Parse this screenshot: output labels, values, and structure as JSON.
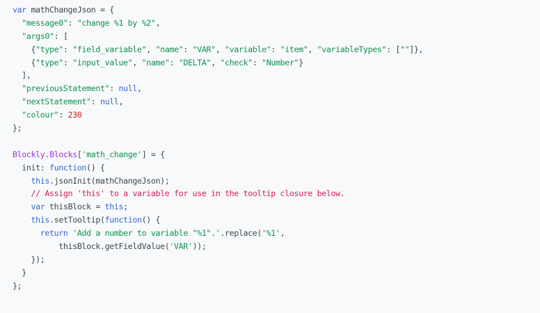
{
  "colors": {
    "background": "#f8f9fa",
    "plain": "#37474f",
    "keyword": "#3367d6",
    "string": "#0d904f",
    "number": "#c5221f",
    "comment": "#d81b60",
    "identifier": "#9334e6"
  },
  "code": {
    "lines": [
      [
        {
          "t": "kw",
          "v": "var"
        },
        {
          "t": "pl",
          "v": " mathChangeJson = {"
        }
      ],
      [
        {
          "t": "pl",
          "v": "  "
        },
        {
          "t": "str",
          "v": "\"message0\""
        },
        {
          "t": "pl",
          "v": ": "
        },
        {
          "t": "str",
          "v": "\"change %1 by %2\""
        },
        {
          "t": "pl",
          "v": ","
        }
      ],
      [
        {
          "t": "pl",
          "v": "  "
        },
        {
          "t": "str",
          "v": "\"args0\""
        },
        {
          "t": "pl",
          "v": ": ["
        }
      ],
      [
        {
          "t": "pl",
          "v": "    {"
        },
        {
          "t": "str",
          "v": "\"type\""
        },
        {
          "t": "pl",
          "v": ": "
        },
        {
          "t": "str",
          "v": "\"field_variable\""
        },
        {
          "t": "pl",
          "v": ", "
        },
        {
          "t": "str",
          "v": "\"name\""
        },
        {
          "t": "pl",
          "v": ": "
        },
        {
          "t": "str",
          "v": "\"VAR\""
        },
        {
          "t": "pl",
          "v": ", "
        },
        {
          "t": "str",
          "v": "\"variable\""
        },
        {
          "t": "pl",
          "v": ": "
        },
        {
          "t": "str",
          "v": "\"item\""
        },
        {
          "t": "pl",
          "v": ", "
        },
        {
          "t": "str",
          "v": "\"variableTypes\""
        },
        {
          "t": "pl",
          "v": ": ["
        },
        {
          "t": "str",
          "v": "\"\""
        },
        {
          "t": "pl",
          "v": "]},"
        }
      ],
      [
        {
          "t": "pl",
          "v": "    {"
        },
        {
          "t": "str",
          "v": "\"type\""
        },
        {
          "t": "pl",
          "v": ": "
        },
        {
          "t": "str",
          "v": "\"input_value\""
        },
        {
          "t": "pl",
          "v": ", "
        },
        {
          "t": "str",
          "v": "\"name\""
        },
        {
          "t": "pl",
          "v": ": "
        },
        {
          "t": "str",
          "v": "\"DELTA\""
        },
        {
          "t": "pl",
          "v": ", "
        },
        {
          "t": "str",
          "v": "\"check\""
        },
        {
          "t": "pl",
          "v": ": "
        },
        {
          "t": "str",
          "v": "\"Number\""
        },
        {
          "t": "pl",
          "v": "}"
        }
      ],
      [
        {
          "t": "pl",
          "v": "  ],"
        }
      ],
      [
        {
          "t": "pl",
          "v": "  "
        },
        {
          "t": "str",
          "v": "\"previousStatement\""
        },
        {
          "t": "pl",
          "v": ": "
        },
        {
          "t": "kw",
          "v": "null"
        },
        {
          "t": "pl",
          "v": ","
        }
      ],
      [
        {
          "t": "pl",
          "v": "  "
        },
        {
          "t": "str",
          "v": "\"nextStatement\""
        },
        {
          "t": "pl",
          "v": ": "
        },
        {
          "t": "kw",
          "v": "null"
        },
        {
          "t": "pl",
          "v": ","
        }
      ],
      [
        {
          "t": "pl",
          "v": "  "
        },
        {
          "t": "str",
          "v": "\"colour\""
        },
        {
          "t": "pl",
          "v": ": "
        },
        {
          "t": "num",
          "v": "230"
        }
      ],
      [
        {
          "t": "pl",
          "v": "};"
        }
      ],
      [
        {
          "t": "pl",
          "v": ""
        }
      ],
      [
        {
          "t": "fn",
          "v": "Blockly"
        },
        {
          "t": "pl",
          "v": "."
        },
        {
          "t": "fn",
          "v": "Blocks"
        },
        {
          "t": "pl",
          "v": "["
        },
        {
          "t": "str",
          "v": "'math_change'"
        },
        {
          "t": "pl",
          "v": "] = {"
        }
      ],
      [
        {
          "t": "pl",
          "v": "  init: "
        },
        {
          "t": "kw",
          "v": "function"
        },
        {
          "t": "pl",
          "v": "() {"
        }
      ],
      [
        {
          "t": "pl",
          "v": "    "
        },
        {
          "t": "kw",
          "v": "this"
        },
        {
          "t": "pl",
          "v": ".jsonInit(mathChangeJson);"
        }
      ],
      [
        {
          "t": "pl",
          "v": "    "
        },
        {
          "t": "cmt",
          "v": "// Assign 'this' to a variable for use in the tooltip closure below."
        }
      ],
      [
        {
          "t": "pl",
          "v": "    "
        },
        {
          "t": "kw",
          "v": "var"
        },
        {
          "t": "pl",
          "v": " thisBlock = "
        },
        {
          "t": "kw",
          "v": "this"
        },
        {
          "t": "pl",
          "v": ";"
        }
      ],
      [
        {
          "t": "pl",
          "v": "    "
        },
        {
          "t": "kw",
          "v": "this"
        },
        {
          "t": "pl",
          "v": ".setTooltip("
        },
        {
          "t": "kw",
          "v": "function"
        },
        {
          "t": "pl",
          "v": "() {"
        }
      ],
      [
        {
          "t": "pl",
          "v": "      "
        },
        {
          "t": "kw",
          "v": "return"
        },
        {
          "t": "pl",
          "v": " "
        },
        {
          "t": "str",
          "v": "'Add a number to variable \"%1\".'"
        },
        {
          "t": "pl",
          "v": ".replace("
        },
        {
          "t": "str",
          "v": "'%1'"
        },
        {
          "t": "pl",
          "v": ","
        }
      ],
      [
        {
          "t": "pl",
          "v": "          thisBlock.getFieldValue("
        },
        {
          "t": "str",
          "v": "'VAR'"
        },
        {
          "t": "pl",
          "v": "));"
        }
      ],
      [
        {
          "t": "pl",
          "v": "    });"
        }
      ],
      [
        {
          "t": "pl",
          "v": "  }"
        }
      ],
      [
        {
          "t": "pl",
          "v": "};"
        }
      ]
    ]
  }
}
